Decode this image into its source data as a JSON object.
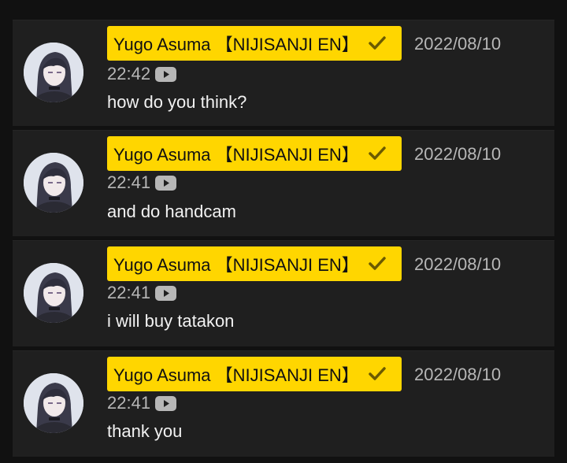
{
  "colors": {
    "page_background": "#111111",
    "card_background": "#1f1f1f",
    "owner_badge": "#ffd600",
    "meta_text": "#b7b7b7",
    "message_text": "#f2f2f2"
  },
  "messages": [
    {
      "author": "Yugo Asuma 【NIJISANJI EN】",
      "verified_icon": "check-icon",
      "date": "2022/08/10",
      "time": "22:42",
      "platform_icon": "youtube-icon",
      "text": "how do you think?"
    },
    {
      "author": "Yugo Asuma 【NIJISANJI EN】",
      "verified_icon": "check-icon",
      "date": "2022/08/10",
      "time": "22:41",
      "platform_icon": "youtube-icon",
      "text": "and do handcam"
    },
    {
      "author": "Yugo Asuma 【NIJISANJI EN】",
      "verified_icon": "check-icon",
      "date": "2022/08/10",
      "time": "22:41",
      "platform_icon": "youtube-icon",
      "text": "i will buy tatakon"
    },
    {
      "author": "Yugo Asuma 【NIJISANJI EN】",
      "verified_icon": "check-icon",
      "date": "2022/08/10",
      "time": "22:41",
      "platform_icon": "youtube-icon",
      "text": "thank you"
    }
  ]
}
